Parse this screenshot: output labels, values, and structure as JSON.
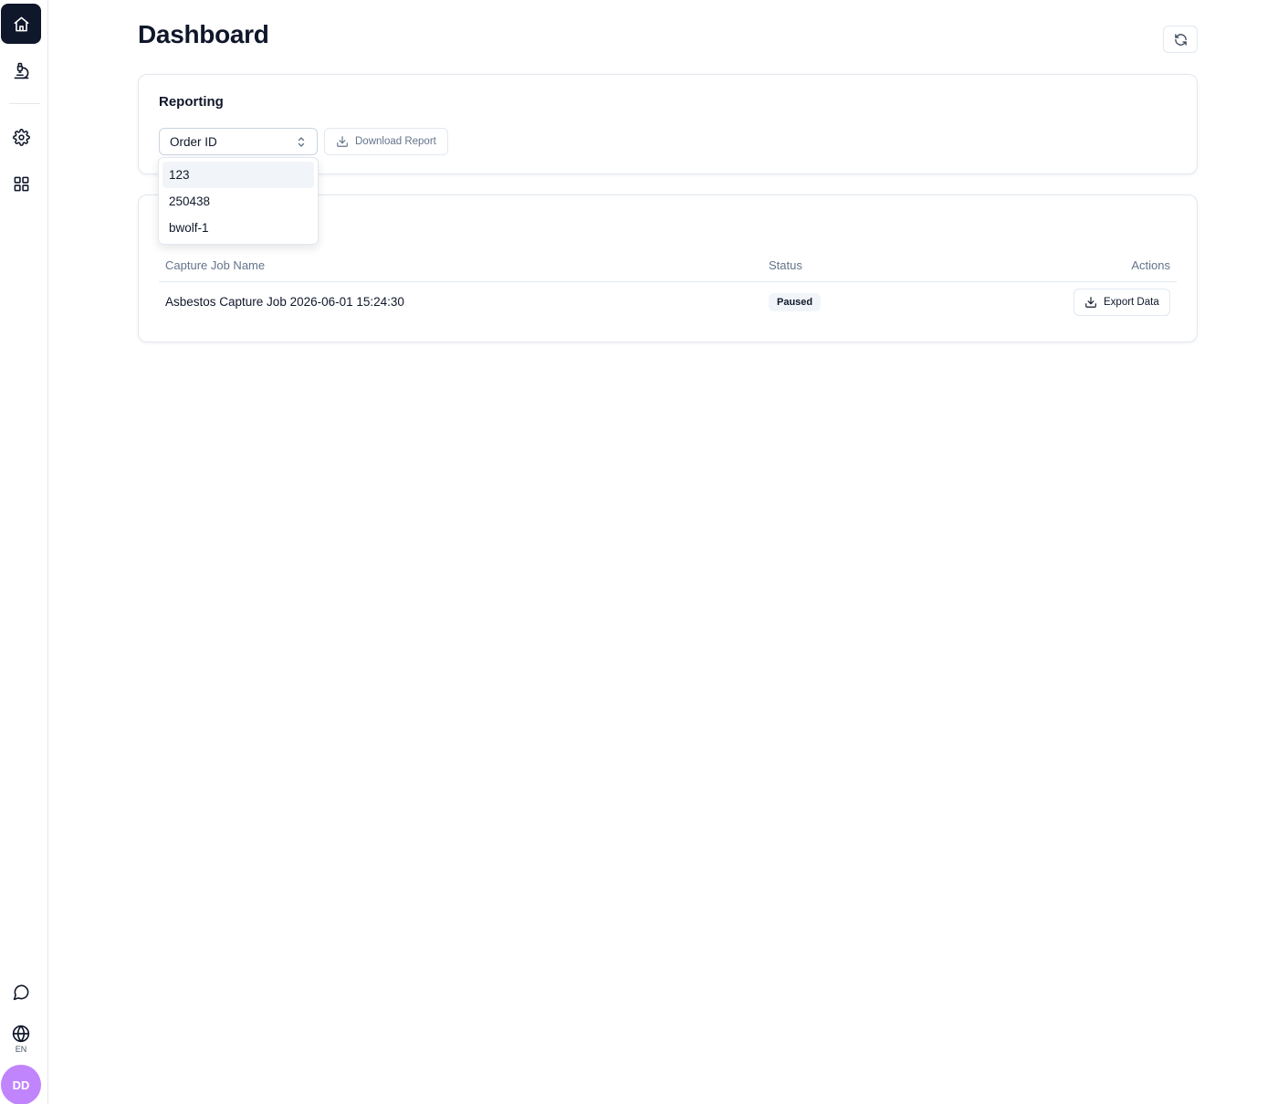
{
  "sidebar": {
    "top_items": [
      {
        "icon": "home-icon",
        "active": true
      },
      {
        "icon": "microscope-icon",
        "active": false
      }
    ],
    "tool_items": [
      {
        "icon": "gear-icon"
      },
      {
        "icon": "grid-icon"
      }
    ],
    "bottom": {
      "chat_icon": "chat-bubble-icon",
      "language_icon": "globe-icon",
      "language_code": "EN",
      "avatar_initials": "DD",
      "avatar_color": "#c084fc"
    }
  },
  "header": {
    "title": "Dashboard",
    "refresh_icon": "refresh-icon"
  },
  "reporting": {
    "title": "Reporting",
    "select_value": "Order ID",
    "download_label": "Download Report",
    "dropdown_options": [
      "123",
      "250438",
      "bwolf-1"
    ],
    "highlighted_option": "123"
  },
  "jobs": {
    "columns": [
      "Capture Job Name",
      "Status",
      "Actions"
    ],
    "rows": [
      {
        "name": "Asbestos Capture Job 2026-06-01 15:24:30",
        "status": "Paused",
        "action_label": "Export Data"
      }
    ]
  },
  "colors": {
    "accent": "#0f172a",
    "muted_text": "#64748b",
    "border": "#e2e8f0",
    "badge_bg": "#f1f5f9"
  }
}
